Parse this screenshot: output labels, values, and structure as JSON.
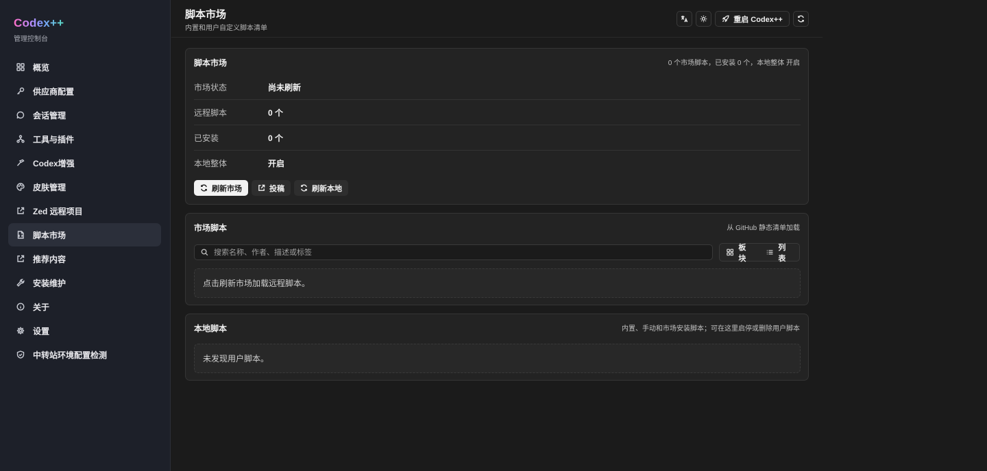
{
  "brand": {
    "title": "Codex++",
    "subtitle": "管理控制台"
  },
  "sidebar": {
    "items": [
      {
        "label": "概览",
        "icon": "grid-icon"
      },
      {
        "label": "供应商配置",
        "icon": "key-icon"
      },
      {
        "label": "会话管理",
        "icon": "chat-bubble-icon"
      },
      {
        "label": "工具与插件",
        "icon": "network-icon"
      },
      {
        "label": "Codex增强",
        "icon": "hammer-icon"
      },
      {
        "label": "皮肤管理",
        "icon": "palette-icon"
      },
      {
        "label": "Zed 远程项目",
        "icon": "external-link-icon"
      },
      {
        "label": "脚本市场",
        "icon": "script-file-icon",
        "active": true
      },
      {
        "label": "推荐内容",
        "icon": "external-link-icon"
      },
      {
        "label": "安装维护",
        "icon": "wrench-icon"
      },
      {
        "label": "关于",
        "icon": "info-icon"
      },
      {
        "label": "设置",
        "icon": "gear-icon"
      },
      {
        "label": "中转站环境配置检测",
        "icon": "shield-icon"
      }
    ]
  },
  "header": {
    "title": "脚本市场",
    "subtitle": "内置和用户自定义脚本清单",
    "restart_label": "重启 Codex++"
  },
  "market_card": {
    "title": "脚本市场",
    "summary": "0 个市场脚本，已安装 0 个，本地整体 开启",
    "rows": [
      {
        "key": "市场状态",
        "value": "尚未刷新"
      },
      {
        "key": "远程脚本",
        "value": "0 个"
      },
      {
        "key": "已安装",
        "value": "0 个"
      },
      {
        "key": "本地整体",
        "value": "开启"
      }
    ],
    "buttons": {
      "refresh_market": "刷新市场",
      "submit": "投稿",
      "refresh_local": "刷新本地"
    }
  },
  "market_scripts": {
    "title": "市场脚本",
    "note": "从 GitHub 静态清单加载",
    "search_placeholder": "搜索名称、作者、描述或标签",
    "view_grid": "板块",
    "view_list": "列表",
    "empty": "点击刷新市场加载远程脚本。"
  },
  "local_scripts": {
    "title": "本地脚本",
    "note": "内置、手动和市场安装脚本；可在这里启停或删除用户脚本",
    "empty": "未发现用户脚本。"
  }
}
